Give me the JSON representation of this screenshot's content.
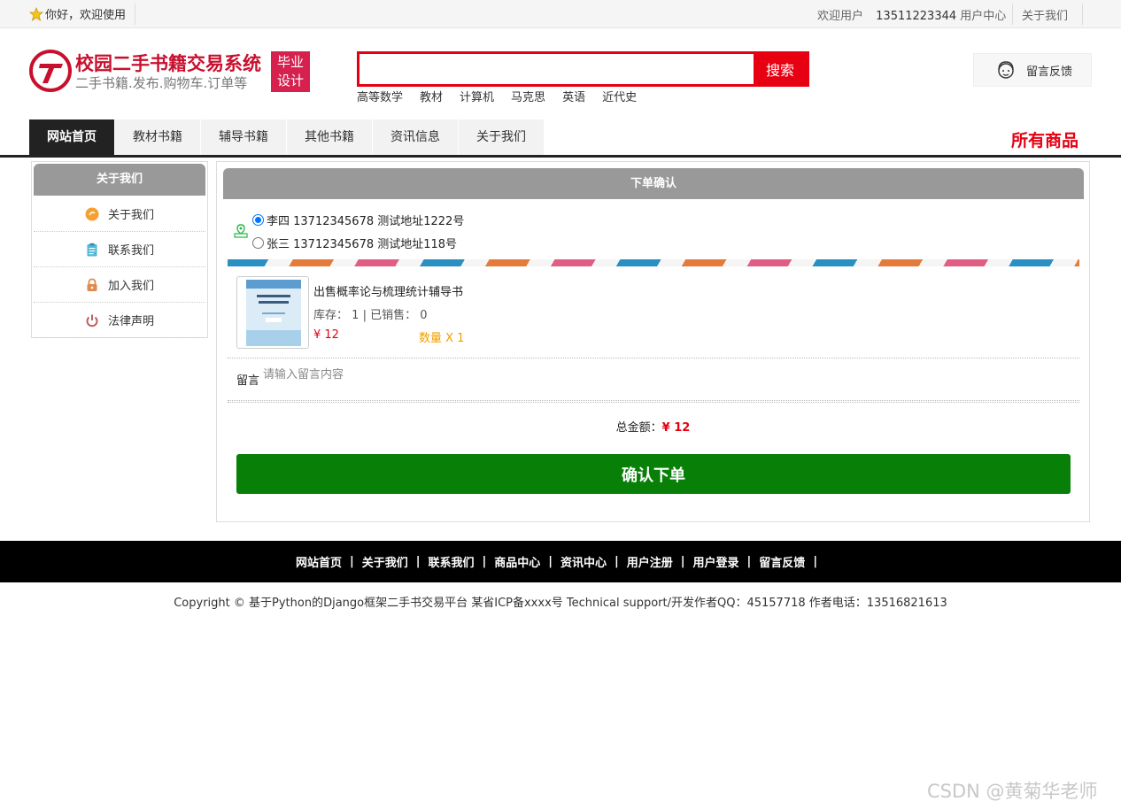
{
  "topbar": {
    "welcome": "你好，欢迎使用",
    "user_prefix": "欢迎用户",
    "username": "13511223344",
    "user_center": "用户中心",
    "about": "关于我们"
  },
  "header": {
    "logo_title": "校园二手书籍交易系统",
    "logo_subtitle": "二手书籍.发布.购物车.订单等",
    "badge_line1": "毕业",
    "badge_line2": "设计",
    "search_value": "",
    "search_button": "搜索",
    "hotwords": [
      "高等数学",
      "教材",
      "计算机",
      "马克思",
      "英语",
      "近代史"
    ],
    "feedback": "留言反馈"
  },
  "nav": {
    "items": [
      "网站首页",
      "教材书籍",
      "辅导书籍",
      "其他书籍",
      "资讯信息",
      "关于我们"
    ],
    "active": "网站首页",
    "right_label": "所有商品"
  },
  "sidebar": {
    "title": "关于我们",
    "items": [
      {
        "label": "关于我们",
        "icon": "orange-circle-icon",
        "color": "#f5a030"
      },
      {
        "label": "联系我们",
        "icon": "clipboard-icon",
        "color": "#4fb8d8"
      },
      {
        "label": "加入我们",
        "icon": "lock-icon",
        "color": "#e08a50"
      },
      {
        "label": "法律声明",
        "icon": "power-icon",
        "color": "#c06060"
      }
    ]
  },
  "order": {
    "title": "下单确认",
    "addresses": [
      {
        "text": "李四 13712345678 测试地址1222号",
        "selected": true
      },
      {
        "text": "张三 13712345678 测试地址118号",
        "selected": false
      }
    ],
    "product": {
      "title": "出售概率论与梳理统计辅导书",
      "stock_label": "库存：",
      "stock": "1",
      "sold_label": "| 已销售：",
      "sold": "0",
      "price": "¥ 12",
      "quantity": "数量 X 1",
      "cover_text": "概率论与数理统计"
    },
    "message_label": "留言",
    "message_placeholder": "请输入留言内容",
    "total_label": "总金额：",
    "total_amount": "¥ 12",
    "confirm_button": "确认下单"
  },
  "footer": {
    "links": [
      "网站首页",
      "关于我们",
      "联系我们",
      "商品中心",
      "资讯中心",
      "用户注册",
      "用户登录",
      "留言反馈"
    ],
    "copyright": "Copyright © 基于Python的Django框架二手书交易平台 某省ICP备xxxx号    Technical support/开发作者QQ：45157718     作者电话：13516821613"
  },
  "watermark": "CSDN @黄菊华老师",
  "colors": {
    "accent_red": "#e60012",
    "confirm_green": "#088008",
    "nav_dark": "#222222",
    "panel_grey": "#999999"
  }
}
